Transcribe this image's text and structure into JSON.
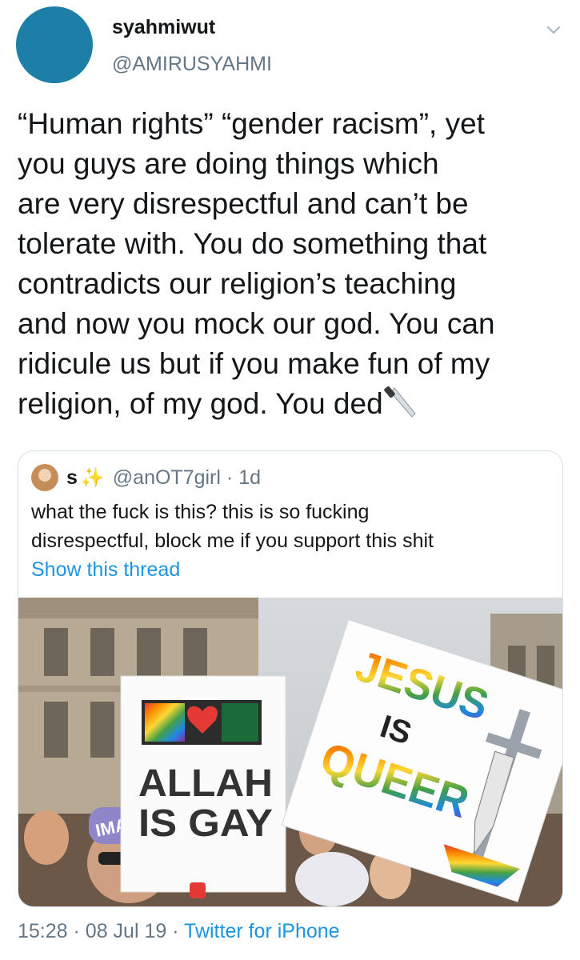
{
  "author": {
    "display_name": "syahmiwut",
    "handle": "@AMIRUSYAHMI"
  },
  "tweet": {
    "text_lines": [
      "“Human rights” “gender racism”, yet",
      "you guys are doing things which",
      "are very disrespectful and can’t be",
      "tolerate with. You do something that",
      "contradicts our religion’s teaching",
      "and now you mock our god. You can",
      "ridicule us but if you make fun of my",
      "religion, of my god. You ded"
    ],
    "emoji": "knife-icon"
  },
  "quoted_tweet": {
    "name": "s",
    "name_emoji": "sparkle-icon",
    "handle": "@anOT7girl",
    "separator": "·",
    "age": "1d",
    "text_lines": [
      "what the fuck is this? this is so fucking",
      "disrespectful, block me if you support this shit"
    ],
    "link": "Show this thread",
    "photo": {
      "sign_left_lines": [
        "ALLAH",
        "IS GAY"
      ],
      "sign_right_words": [
        "JESUS",
        "IS",
        "QUEER"
      ],
      "hat_text": "IMAM"
    }
  },
  "footer": {
    "time": "15:28",
    "dot": "·",
    "date": "08 Jul 19",
    "source": "Twitter for iPhone"
  },
  "colors": {
    "avatar": "#1d7fa8",
    "link": "#1b95e0",
    "secondary_text": "#657786"
  }
}
